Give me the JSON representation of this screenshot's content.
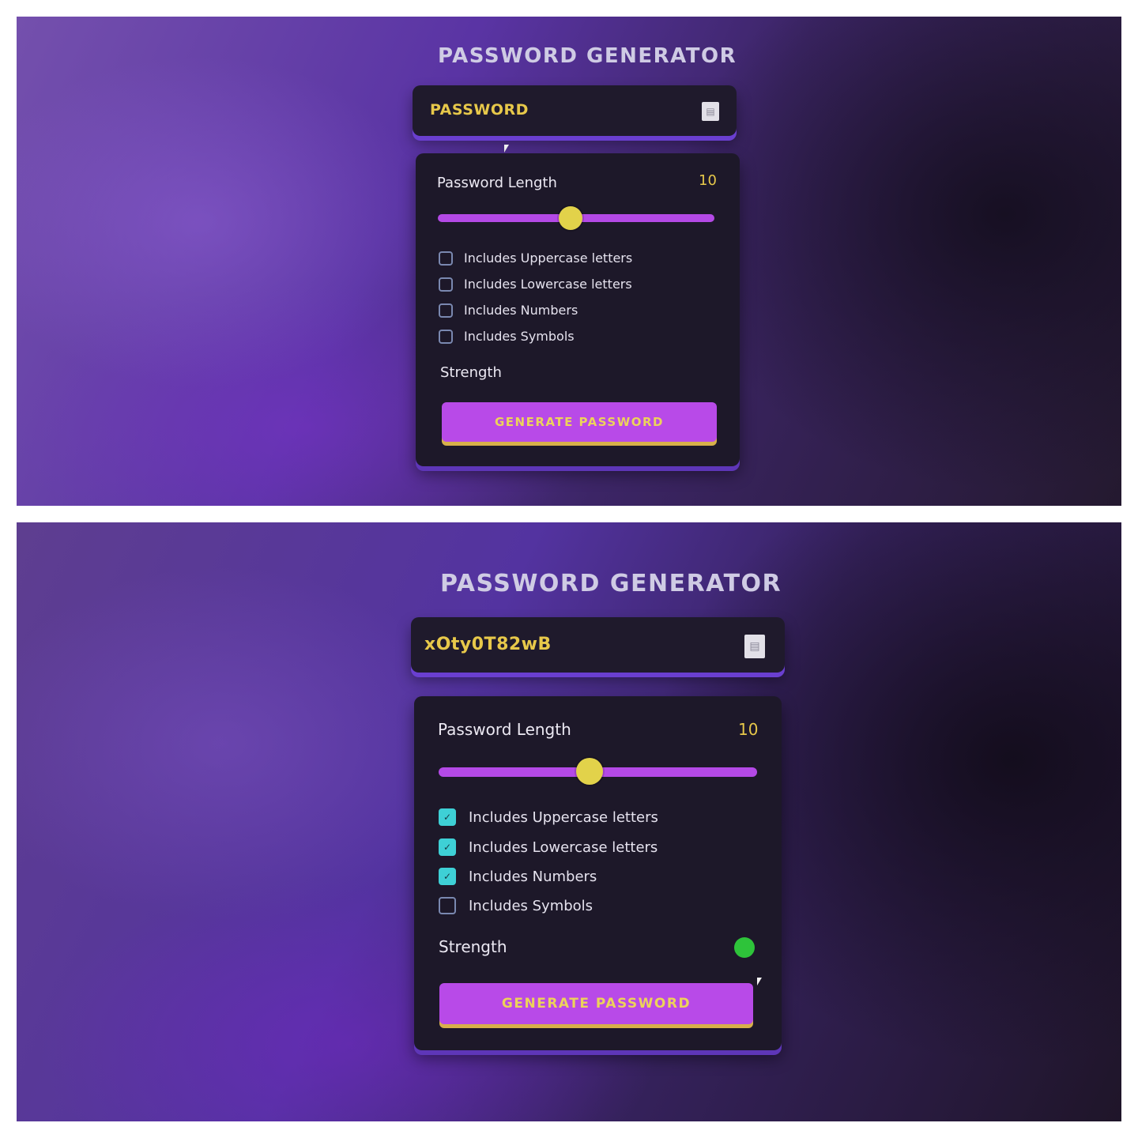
{
  "screens": [
    {
      "title": "PASSWORD GENERATOR",
      "password_display": "PASSWORD",
      "copy_icon": "clipboard-icon",
      "length_label": "Password Length",
      "length_value": "10",
      "slider": {
        "value": 10,
        "fraction": 0.48
      },
      "options": [
        {
          "label": "Includes Uppercase letters",
          "checked": false
        },
        {
          "label": "Includes Lowercase letters",
          "checked": false
        },
        {
          "label": "Includes Numbers",
          "checked": false
        },
        {
          "label": "Includes Symbols",
          "checked": false
        }
      ],
      "strength_label": "Strength",
      "strength_indicator": null,
      "generate_label": "GENERATE PASSWORD"
    },
    {
      "title": "PASSWORD GENERATOR",
      "password_display": "xOty0T82wB",
      "copy_icon": "clipboard-icon",
      "length_label": "Password Length",
      "length_value": "10",
      "slider": {
        "value": 10,
        "fraction": 0.48
      },
      "options": [
        {
          "label": "Includes Uppercase letters",
          "checked": true
        },
        {
          "label": "Includes Lowercase letters",
          "checked": true
        },
        {
          "label": "Includes Numbers",
          "checked": true
        },
        {
          "label": "Includes Symbols",
          "checked": false
        }
      ],
      "strength_label": "Strength",
      "strength_indicator": {
        "color": "#2ec33a"
      },
      "generate_label": "GENERATE PASSWORD"
    }
  ],
  "colors": {
    "accent_purple": "#b449e6",
    "accent_yellow": "#e7c84a",
    "checkbox_checked": "#3ed0d6",
    "panel_bg": "#1d1829"
  }
}
